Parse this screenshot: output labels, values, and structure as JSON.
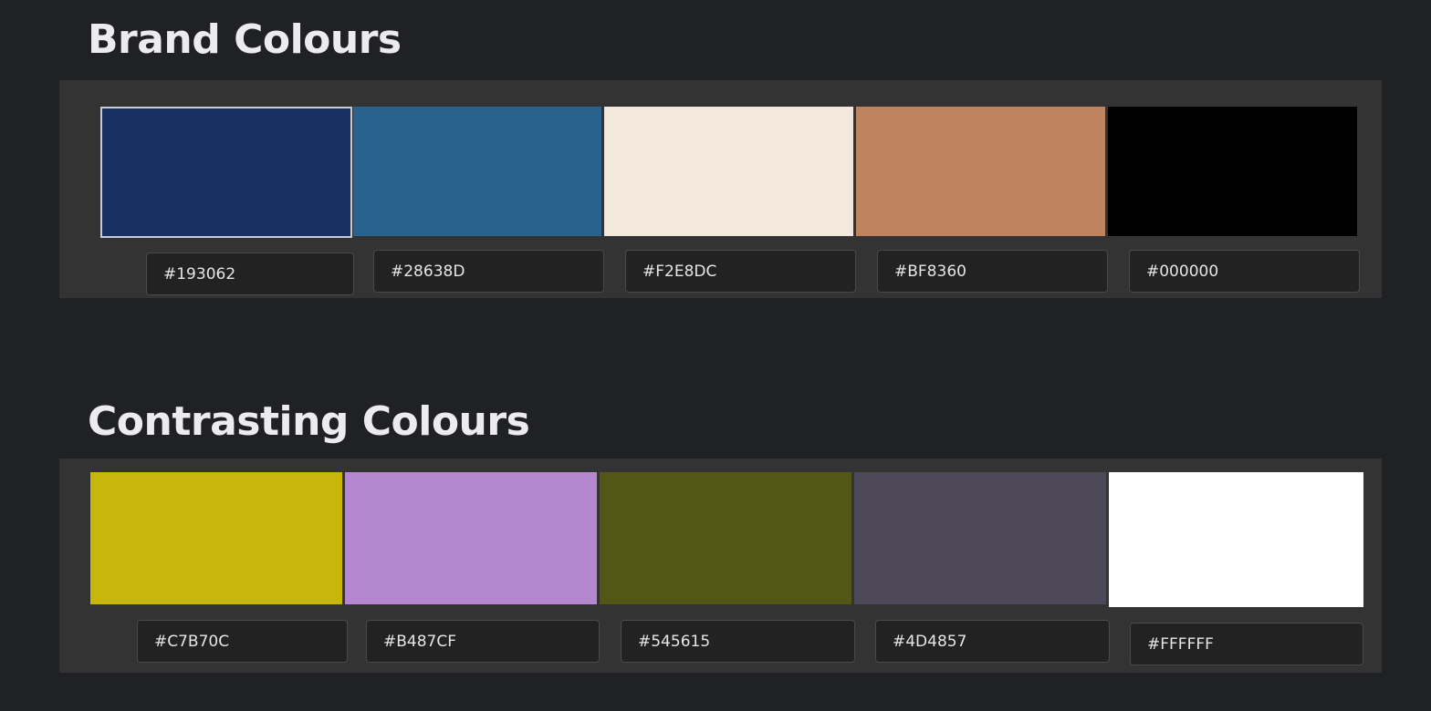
{
  "brand": {
    "title": "Brand Colours",
    "colors": [
      {
        "hex": "#193062",
        "label": "#193062",
        "selected": true
      },
      {
        "hex": "#28638D",
        "label": "#28638D"
      },
      {
        "hex": "#F2E8DC",
        "label": "#F2E8DC"
      },
      {
        "hex": "#BF8360",
        "label": "#BF8360"
      },
      {
        "hex": "#000000",
        "label": "#000000"
      }
    ]
  },
  "contrasting": {
    "title": "Contrasting Colours",
    "colors": [
      {
        "hex": "#C7B70C",
        "label": "#C7B70C"
      },
      {
        "hex": "#B487CF",
        "label": "#B487CF"
      },
      {
        "hex": "#545615",
        "label": "#545615"
      },
      {
        "hex": "#4D4857",
        "label": "#4D4857"
      },
      {
        "hex": "#FFFFFF",
        "label": "#FFFFFF"
      }
    ]
  }
}
